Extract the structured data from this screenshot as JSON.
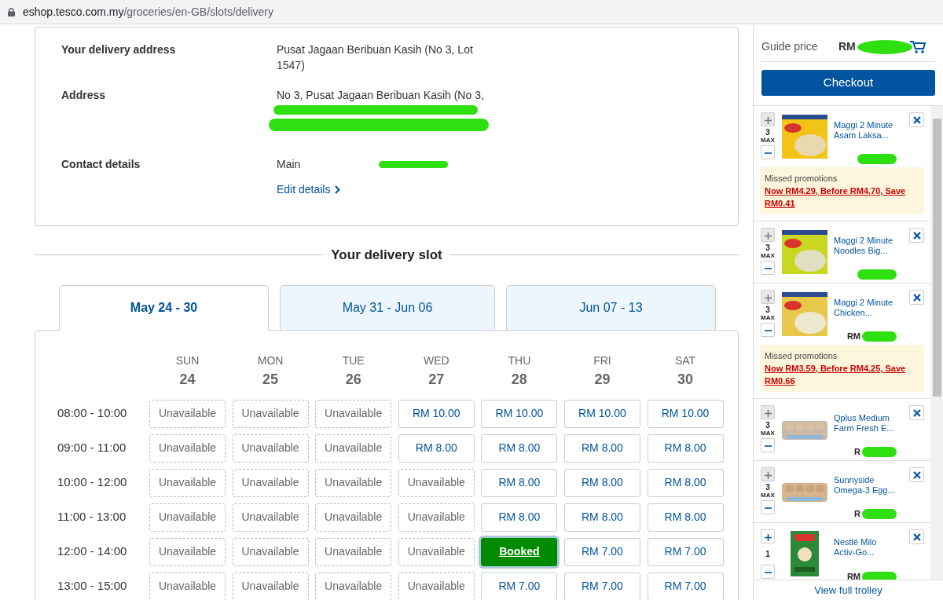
{
  "address_bar": {
    "url": "eshop.tesco.com.my/groceries/en-GB/slots/delivery"
  },
  "details": [
    {
      "label": "Your delivery address",
      "lines": [
        "Pusat Jagaan Beribuan Kasih (No 3, Lot 1547)"
      ],
      "redacted": false
    },
    {
      "label": "Address",
      "lines": [
        "No 3, Pusat Jagaan Beribuan Kasih (No 3,"
      ],
      "redacted": true
    },
    {
      "label": "Contact details",
      "lines": [
        "Main"
      ],
      "redacted": true,
      "link": "Edit details"
    }
  ],
  "section_title": "Your delivery slot",
  "week_tabs": [
    {
      "label": "May 24 - 30",
      "selected": true
    },
    {
      "label": "May 31 - Jun 06",
      "selected": false
    },
    {
      "label": "Jun 07 - 13",
      "selected": false
    }
  ],
  "days": [
    {
      "name": "SUN",
      "date": "24"
    },
    {
      "name": "MON",
      "date": "25"
    },
    {
      "name": "TUE",
      "date": "26"
    },
    {
      "name": "WED",
      "date": "27"
    },
    {
      "name": "THU",
      "date": "28"
    },
    {
      "name": "FRI",
      "date": "29"
    },
    {
      "name": "SAT",
      "date": "30"
    }
  ],
  "slots": [
    {
      "time": "08:00 - 10:00",
      "cells": [
        {
          "kind": "unavailable",
          "text": "Unavailable"
        },
        {
          "kind": "unavailable",
          "text": "Unavailable"
        },
        {
          "kind": "unavailable",
          "text": "Unavailable"
        },
        {
          "kind": "price",
          "text": "RM 10.00"
        },
        {
          "kind": "price",
          "text": "RM 10.00"
        },
        {
          "kind": "price",
          "text": "RM 10.00"
        },
        {
          "kind": "price",
          "text": "RM 10.00"
        }
      ]
    },
    {
      "time": "09:00 - 11:00",
      "cells": [
        {
          "kind": "unavailable",
          "text": "Unavailable"
        },
        {
          "kind": "unavailable",
          "text": "Unavailable"
        },
        {
          "kind": "unavailable",
          "text": "Unavailable"
        },
        {
          "kind": "price",
          "text": "RM 8.00"
        },
        {
          "kind": "price",
          "text": "RM 8.00"
        },
        {
          "kind": "price",
          "text": "RM 8.00"
        },
        {
          "kind": "price",
          "text": "RM 8.00"
        }
      ]
    },
    {
      "time": "10:00 - 12:00",
      "cells": [
        {
          "kind": "unavailable",
          "text": "Unavailable"
        },
        {
          "kind": "unavailable",
          "text": "Unavailable"
        },
        {
          "kind": "unavailable",
          "text": "Unavailable"
        },
        {
          "kind": "unavailable",
          "text": "Unavailable"
        },
        {
          "kind": "price",
          "text": "RM 8.00"
        },
        {
          "kind": "price",
          "text": "RM 8.00"
        },
        {
          "kind": "price",
          "text": "RM 8.00"
        }
      ]
    },
    {
      "time": "11:00 - 13:00",
      "cells": [
        {
          "kind": "unavailable",
          "text": "Unavailable"
        },
        {
          "kind": "unavailable",
          "text": "Unavailable"
        },
        {
          "kind": "unavailable",
          "text": "Unavailable"
        },
        {
          "kind": "unavailable",
          "text": "Unavailable"
        },
        {
          "kind": "price",
          "text": "RM 8.00"
        },
        {
          "kind": "price",
          "text": "RM 8.00"
        },
        {
          "kind": "price",
          "text": "RM 8.00"
        }
      ]
    },
    {
      "time": "12:00 - 14:00",
      "cells": [
        {
          "kind": "unavailable",
          "text": "Unavailable"
        },
        {
          "kind": "unavailable",
          "text": "Unavailable"
        },
        {
          "kind": "unavailable",
          "text": "Unavailable"
        },
        {
          "kind": "unavailable",
          "text": "Unavailable"
        },
        {
          "kind": "booked",
          "text": "Booked"
        },
        {
          "kind": "price",
          "text": "RM 7.00"
        },
        {
          "kind": "price",
          "text": "RM 7.00"
        }
      ]
    },
    {
      "time": "13:00 - 15:00",
      "cells": [
        {
          "kind": "unavailable",
          "text": "Unavailable"
        },
        {
          "kind": "unavailable",
          "text": "Unavailable"
        },
        {
          "kind": "unavailable",
          "text": "Unavailable"
        },
        {
          "kind": "unavailable",
          "text": "Unavailable"
        },
        {
          "kind": "price",
          "text": "RM 7.00"
        },
        {
          "kind": "price",
          "text": "RM 7.00"
        },
        {
          "kind": "price",
          "text": "RM 7.00"
        }
      ]
    }
  ],
  "trolley": {
    "guide_label": "Guide price",
    "guide_value": "RM",
    "checkout": "Checkout",
    "footer_link": "View full trolley",
    "items": [
      {
        "name": "Maggi 2 Minute Asam Laksa...",
        "qty": "3",
        "max_label": "MAX",
        "plus_disabled": true,
        "promo": {
          "label": "Missed promotions",
          "text": "Now RM4.29, Before RM4.70, Save RM0.41"
        }
      },
      {
        "name": "Maggi 2 Minute Noodles Big...",
        "qty": "3",
        "max_label": "MAX",
        "plus_disabled": true
      },
      {
        "name": "Maggi 2 Minute Chicken...",
        "qty": "3",
        "max_label": "MAX",
        "plus_disabled": true,
        "price": "RM",
        "promo": {
          "label": "Missed promotions",
          "text": "Now RM3.59, Before RM4.25, Save RM0.66"
        }
      },
      {
        "name": "Qplus Medium Farm Fresh E...",
        "qty": "3",
        "max_label": "MAX",
        "plus_disabled": true,
        "price": "R"
      },
      {
        "name": "Sunnyside Omega-3 Egg...",
        "qty": "3",
        "max_label": "MAX",
        "plus_disabled": true,
        "price": "R"
      },
      {
        "name": "Nestlé Milo Activ-Go...",
        "qty": "1",
        "plus_disabled": false,
        "price": "RM"
      }
    ]
  }
}
